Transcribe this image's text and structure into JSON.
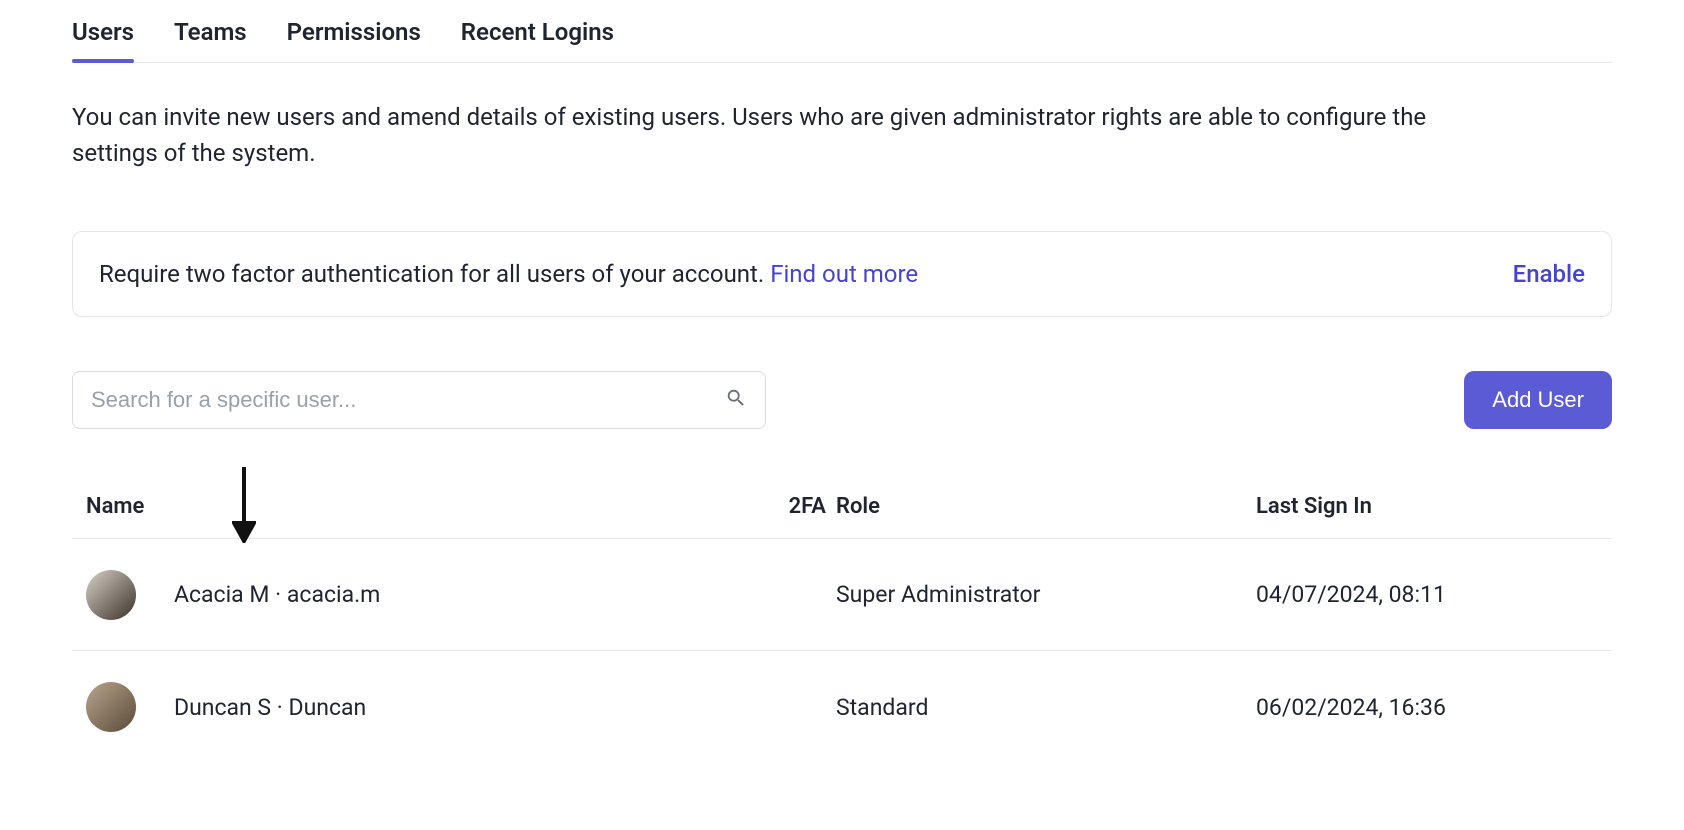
{
  "tabs": [
    {
      "label": "Users",
      "active": true
    },
    {
      "label": "Teams",
      "active": false
    },
    {
      "label": "Permissions",
      "active": false
    },
    {
      "label": "Recent Logins",
      "active": false
    }
  ],
  "description": "You can invite new users and amend details of existing users. Users who are given administrator rights are able to configure the settings of the system.",
  "callout": {
    "text": "Require two factor authentication for all users of your account. ",
    "link_label": "Find out more",
    "action": "Enable"
  },
  "search": {
    "placeholder": "Search for a specific user..."
  },
  "add_user_label": "Add User",
  "columns": {
    "name": "Name",
    "twofa": "2FA",
    "role": "Role",
    "last_signin": "Last Sign In"
  },
  "sort": {
    "column": "name",
    "direction": "desc"
  },
  "users": [
    {
      "display": "Acacia M · acacia.m",
      "twofa": "",
      "role": "Super Administrator",
      "last_signin": "04/07/2024, 08:11"
    },
    {
      "display": "Duncan S · Duncan",
      "twofa": "",
      "role": "Standard",
      "last_signin": "06/02/2024, 16:36"
    }
  ]
}
